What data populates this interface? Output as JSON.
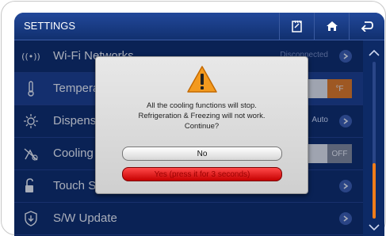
{
  "header": {
    "title": "SETTINGS"
  },
  "rows": [
    {
      "label": "Wi-Fi Networks",
      "value": "Disconnected",
      "icon": "wifi-icon"
    },
    {
      "label": "Temperature",
      "unit_left": "",
      "unit_right": "°F",
      "icon": "thermometer-icon"
    },
    {
      "label": "Dispenser",
      "value": "Auto",
      "icon": "dispenser-light-icon"
    },
    {
      "label": "Cooling Off",
      "toggle_on": "",
      "toggle_off": "OFF",
      "icon": "cooling-off-icon"
    },
    {
      "label": "Touch Screen Lock",
      "icon": "touch-lock-icon"
    },
    {
      "label": "S/W Update",
      "icon": "shield-update-icon"
    }
  ],
  "dialog": {
    "line1": "All the cooling functions will stop.",
    "line2": "Refrigeration & Freezing will not work.",
    "line3": "Continue?",
    "no_label": "No",
    "yes_label": "Yes (press it for 3 seconds)"
  },
  "colors": {
    "accent": "#f07d1a",
    "background": "#0d2a66",
    "danger": "#e01010"
  }
}
